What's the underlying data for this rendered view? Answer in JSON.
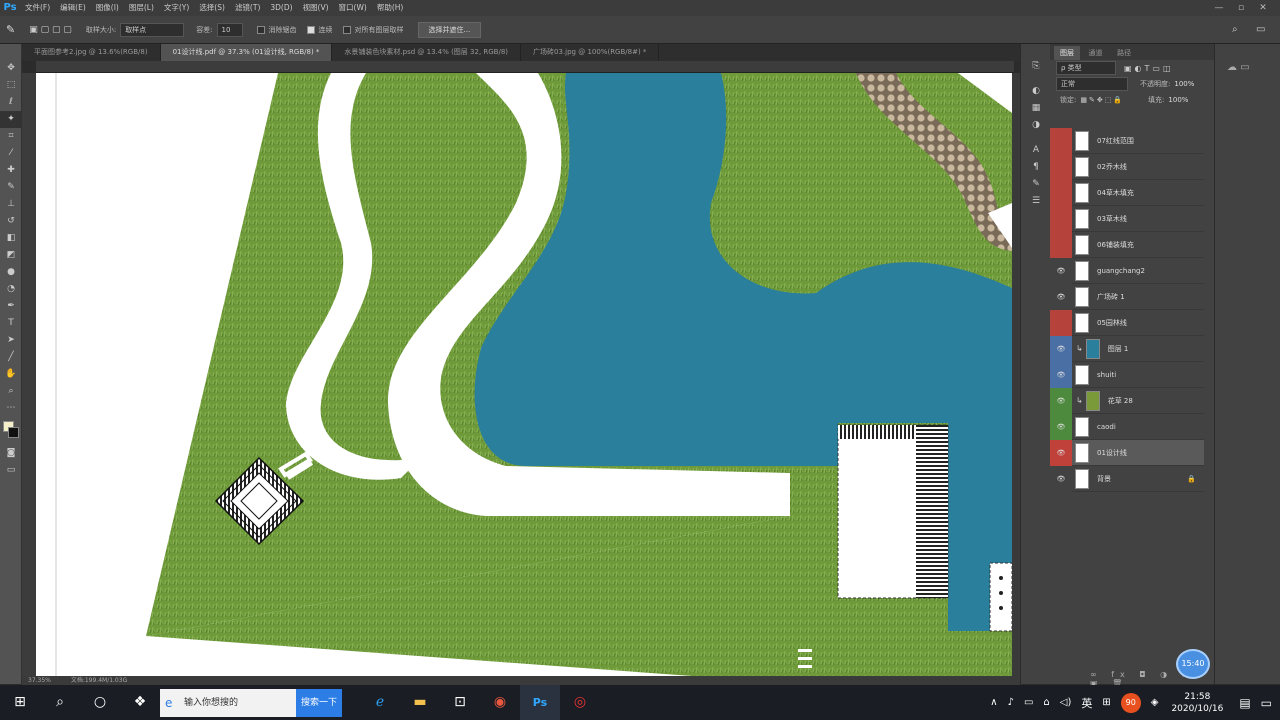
{
  "app": {
    "logo": "Ps",
    "menu": [
      "文件(F)",
      "编辑(E)",
      "图像(I)",
      "图层(L)",
      "文字(Y)",
      "选择(S)",
      "滤镜(T)",
      "3D(D)",
      "视图(V)",
      "窗口(W)",
      "帮助(H)"
    ]
  },
  "window_controls": [
    "—",
    "▫",
    "✕"
  ],
  "options": {
    "sample_size_label": "取样大小:",
    "sample_size_value": "取样点",
    "tolerance_label": "容差:",
    "tolerance_value": "10",
    "antialias_label": "消除锯齿",
    "contiguous_label": "连续",
    "sample_all_label": "对所有图层取样",
    "select_mask_button": "选择并遮住..."
  },
  "tabs": [
    {
      "label": "平面图参考2.jpg @ 13.6%(RGB/8)",
      "active": false
    },
    {
      "label": "01设计线.pdf @ 37.3% (01设计线, RGB/8) *",
      "active": true
    },
    {
      "label": "水景铺装色块素材.psd @ 13.4% (图层 32, RGB/8)",
      "active": false
    },
    {
      "label": "广场砖03.jpg @ 100%(RGB/8#) *",
      "active": false
    }
  ],
  "status": {
    "zoom": "37.35%",
    "doc": "文档:199.4M/1.03G"
  },
  "layers_panel": {
    "tabs": [
      "图层",
      "通道",
      "路径"
    ],
    "filter_label": "ρ 类型",
    "blend_mode": "正常",
    "opacity_label": "不透明度:",
    "opacity_value": "100%",
    "lock_label": "锁定:",
    "fill_label": "填充:",
    "fill_value": "100%",
    "layers": [
      {
        "name": "07红线范围",
        "color": "#b5423b",
        "visible": false,
        "clip": false
      },
      {
        "name": "02乔木线",
        "color": "#b5423b",
        "visible": false,
        "clip": false
      },
      {
        "name": "04草木填充",
        "color": "#b5423b",
        "visible": false,
        "clip": false
      },
      {
        "name": "03草木线",
        "color": "#b5423b",
        "visible": false,
        "clip": false
      },
      {
        "name": "06铺装填充",
        "color": "#b5423b",
        "visible": false,
        "clip": false
      },
      {
        "name": "guangchang2",
        "color": "#424242",
        "visible": true,
        "clip": false
      },
      {
        "name": "广场砖 1",
        "color": "#424242",
        "visible": true,
        "clip": false
      },
      {
        "name": "05园林线",
        "color": "#b5423b",
        "visible": false,
        "clip": false
      },
      {
        "name": "图层 1",
        "color": "#4a6fa5",
        "visible": true,
        "clip": true
      },
      {
        "name": "shuiti",
        "color": "#4a6fa5",
        "visible": true,
        "clip": false
      },
      {
        "name": "花草 28",
        "color": "#4e8a3e",
        "visible": true,
        "clip": true
      },
      {
        "name": "caodi",
        "color": "#4e8a3e",
        "visible": true,
        "clip": false
      },
      {
        "name": "01设计线",
        "color": "#c0403a",
        "visible": true,
        "clip": false
      },
      {
        "name": "背景",
        "color": "#424242",
        "visible": true,
        "clip": false
      }
    ],
    "footer_icons": [
      "link-icon",
      "fx-icon",
      "mask-icon",
      "adjustment-icon",
      "group-icon",
      "new-layer-icon",
      "trash-icon"
    ]
  },
  "taskbar": {
    "search_placeholder": "输入你想搜的",
    "search_button": "搜索一下",
    "lang": "英",
    "time": "21:58",
    "date": "2020/10/16",
    "notification_count": "90"
  },
  "timer_badge": "15:40",
  "colors": {
    "grass": "#6f9a3a",
    "water": "#2a7f9c",
    "accent": "#31a8ff"
  }
}
